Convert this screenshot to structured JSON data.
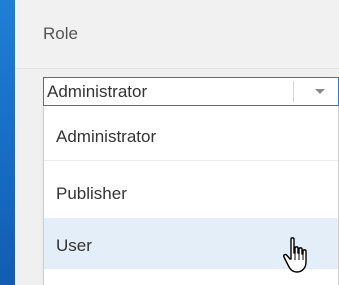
{
  "role_panel": {
    "label": "Role",
    "select": {
      "selected_value": "Administrator",
      "arrow_icon": "chevron-down-icon"
    },
    "dropdown": {
      "options": [
        {
          "label": "Administrator",
          "highlighted": false
        },
        {
          "label": "Publisher",
          "highlighted": false
        },
        {
          "label": "User",
          "highlighted": true
        }
      ]
    }
  },
  "colors": {
    "background_blue": "#1668c0",
    "panel_gray": "#f0f0f0",
    "select_border": "#2f79c9",
    "hover_highlight": "#e4eef8",
    "text": "#333333"
  },
  "cursor_icon": "hand-pointer-icon"
}
